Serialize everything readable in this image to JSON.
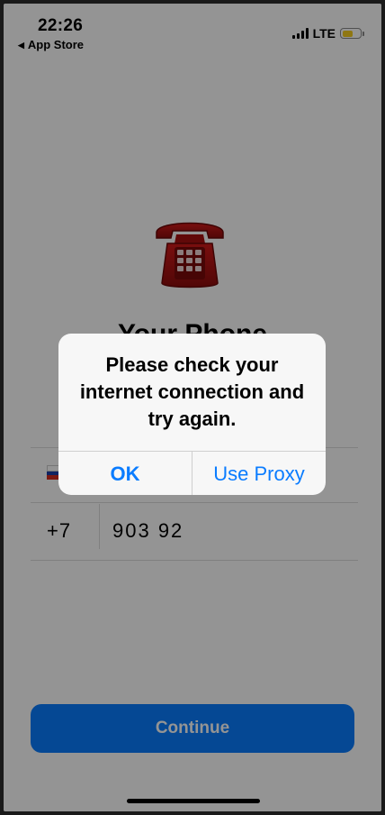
{
  "status_bar": {
    "time": "22:26",
    "back_label": "App Store",
    "network": "LTE",
    "battery_level": 0.5,
    "battery_color": "#f6cd1f"
  },
  "icon": {
    "name": "telephone-icon"
  },
  "page": {
    "title": "Your Phone"
  },
  "phone_entry": {
    "country_flag": "flag-russia-icon",
    "country_code": "+7",
    "number": "903 92"
  },
  "buttons": {
    "continue_label": "Continue"
  },
  "alert": {
    "message": "Please check your internet connection and try again.",
    "ok_label": "OK",
    "proxy_label": "Use Proxy"
  },
  "colors": {
    "accent": "#0a7cff"
  }
}
